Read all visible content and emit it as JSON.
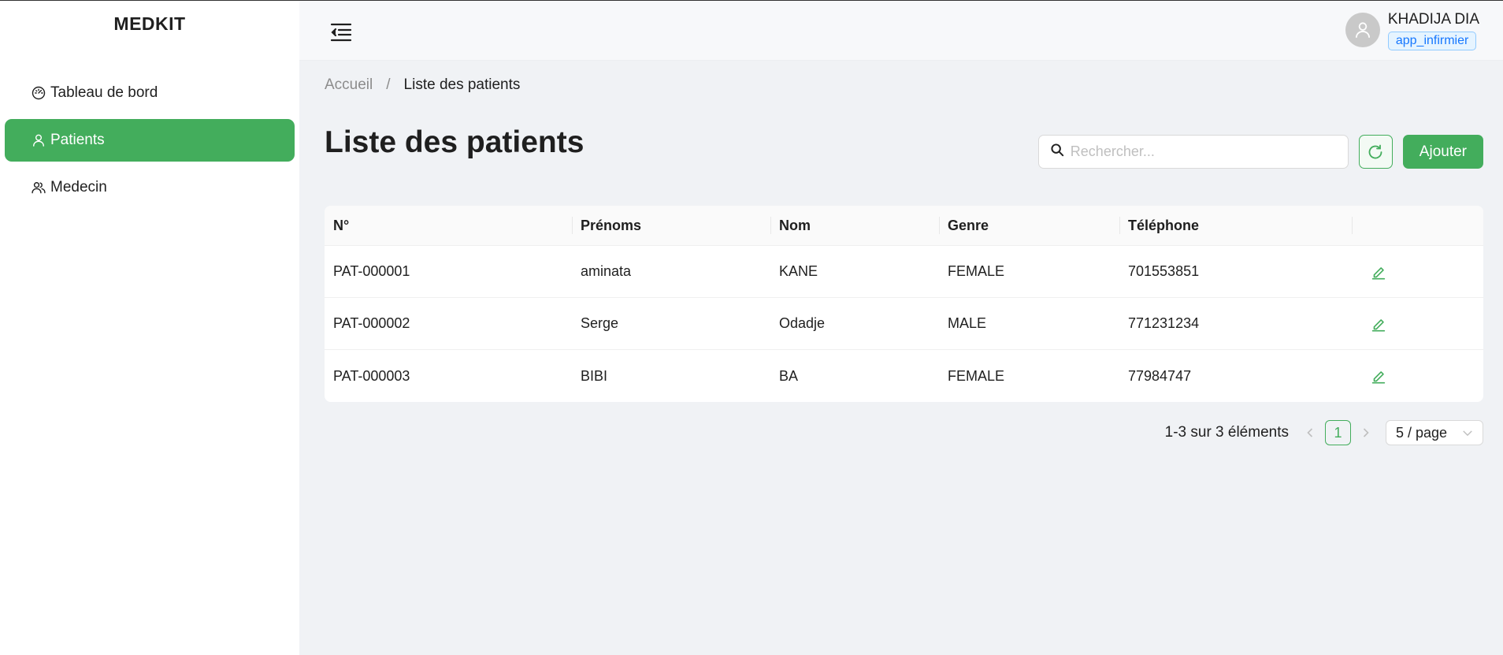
{
  "app": {
    "brand": "MEDKIT"
  },
  "sidebar": {
    "items": [
      {
        "label": "Tableau de bord",
        "icon": "dashboard-icon",
        "active": false
      },
      {
        "label": "Patients",
        "icon": "user-icon",
        "active": true
      },
      {
        "label": "Medecin",
        "icon": "team-icon",
        "active": false
      }
    ]
  },
  "header": {
    "toggle_icon": "menu-fold-icon",
    "user": {
      "name": "KHADIJA DIA",
      "role": "app_infirmier",
      "avatar_icon": "user-avatar-icon"
    }
  },
  "breadcrumb": {
    "home": "Accueil",
    "separator": "/",
    "current": "Liste des patients"
  },
  "page": {
    "title": "Liste des patients"
  },
  "toolbar": {
    "search_placeholder": "Rechercher...",
    "search_value": "",
    "refresh_icon": "reload-icon",
    "add_label": "Ajouter"
  },
  "table": {
    "columns": [
      "N°",
      "Prénoms",
      "Nom",
      "Genre",
      "Téléphone",
      ""
    ],
    "rows": [
      {
        "id": "PAT-000001",
        "prenoms": "aminata",
        "nom": "KANE",
        "genre": "FEMALE",
        "telephone": "701553851"
      },
      {
        "id": "PAT-000002",
        "prenoms": "Serge",
        "nom": "Odadje",
        "genre": "MALE",
        "telephone": "771231234"
      },
      {
        "id": "PAT-000003",
        "prenoms": "BIBI",
        "nom": "BA",
        "genre": "FEMALE",
        "telephone": "77984747"
      }
    ],
    "row_action_icon": "edit-icon"
  },
  "pagination": {
    "total_text": "1-3 sur 3 éléments",
    "current_page": "1",
    "page_size": "5 / page"
  },
  "colors": {
    "accent": "#43ad5c",
    "role_tag": "#1677ff",
    "background": "#f0f2f5"
  }
}
